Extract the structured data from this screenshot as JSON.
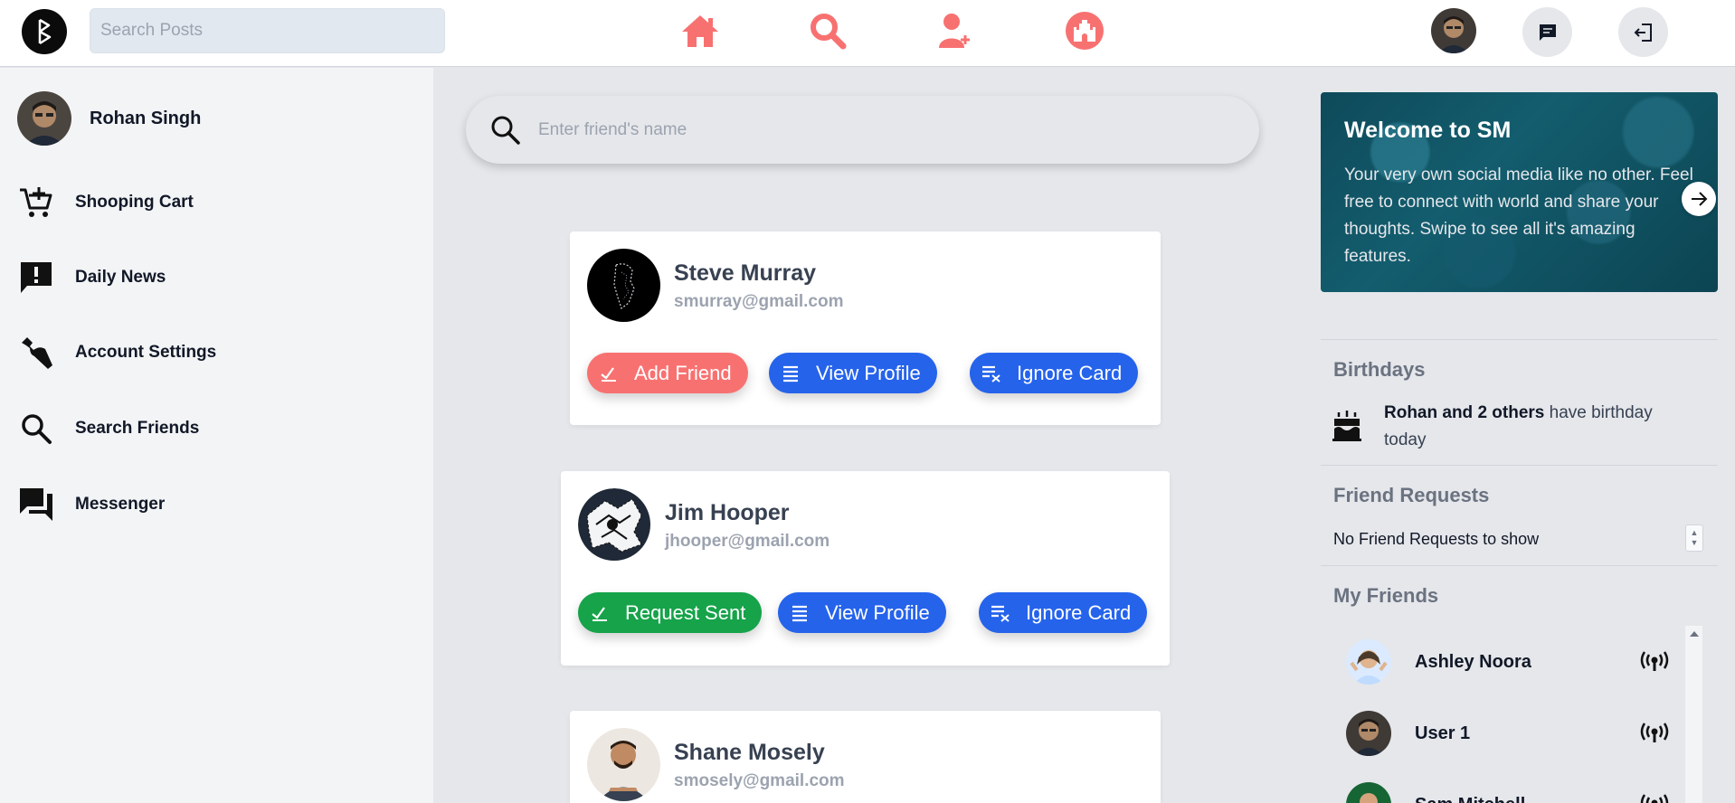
{
  "header": {
    "search_placeholder": "Search Posts",
    "nav": [
      "home-icon",
      "search-icon",
      "add-user-icon",
      "castle-icon"
    ],
    "accent_color": "#f87171"
  },
  "sidebar": {
    "profile_name": "Rohan Singh",
    "items": [
      {
        "label": "Shooping Cart",
        "icon": "cart-add-icon"
      },
      {
        "label": "Daily News",
        "icon": "announcement-icon"
      },
      {
        "label": "Account Settings",
        "icon": "wrench-icon"
      },
      {
        "label": "Search Friends",
        "icon": "search-icon"
      },
      {
        "label": "Messenger",
        "icon": "forum-icon"
      }
    ]
  },
  "main": {
    "search_placeholder": "Enter friend's name",
    "cards": [
      {
        "name": "Steve Murray",
        "email": "smurray@gmail.com",
        "primary_label": "Add Friend",
        "view_label": "View Profile",
        "ignore_label": "Ignore Card"
      },
      {
        "name": "Jim Hooper",
        "email": "jhooper@gmail.com",
        "primary_label": "Request Sent",
        "view_label": "View Profile",
        "ignore_label": "Ignore Card"
      },
      {
        "name": "Shane Mosely",
        "email": "smosely@gmail.com"
      }
    ]
  },
  "right": {
    "welcome_title": "Welcome to SM",
    "welcome_text": "Your very own social media like no other. Feel free to connect with world and share your thoughts. Swipe to see all it's amazing features.",
    "birthdays_title": "Birthdays",
    "birthday_bold": "Rohan and 2 others",
    "birthday_rest": " have birthday today",
    "friend_requests_title": "Friend Requests",
    "friend_requests_empty": "No Friend Requests to show",
    "my_friends_title": "My Friends",
    "friends": [
      {
        "name": "Ashley Noora"
      },
      {
        "name": "User 1"
      },
      {
        "name": "Sam Mitchell"
      }
    ]
  }
}
